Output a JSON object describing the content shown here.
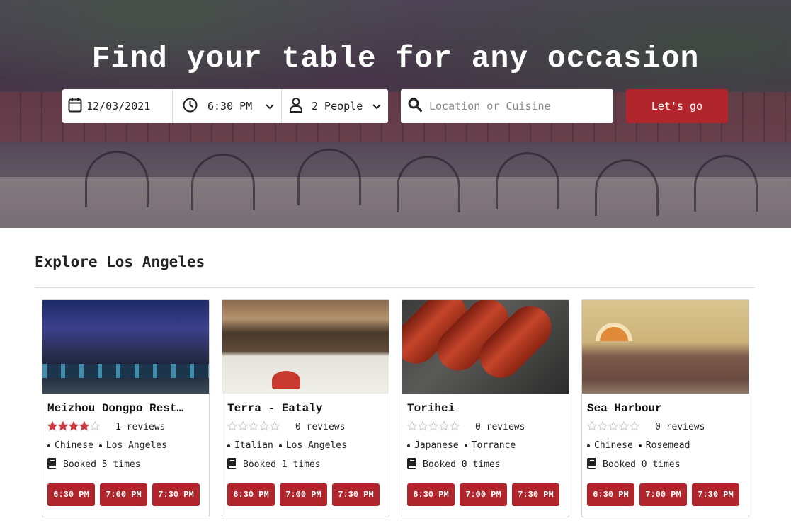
{
  "hero": {
    "title": "Find your table for any occasion",
    "date": "12/03/2021",
    "time": "6:30 PM",
    "party": "2 People",
    "search_placeholder": "Location or Cuisine",
    "go_label": "Let's go"
  },
  "explore": {
    "title": "Explore Los Angeles"
  },
  "colors": {
    "accent": "#b0262c",
    "star": "#d0393f"
  },
  "restaurants": [
    {
      "name": "Meizhou Dongpo Rest…",
      "rating": 4,
      "reviews": "1 reviews",
      "cuisine": "Chinese",
      "location": "Los Angeles",
      "booked": "Booked 5 times",
      "slots": [
        "6:30 PM",
        "7:00 PM",
        "7:30 PM"
      ]
    },
    {
      "name": "Terra - Eataly",
      "rating": 0,
      "reviews": "0 reviews",
      "cuisine": "Italian",
      "location": "Los Angeles",
      "booked": "Booked 1 times",
      "slots": [
        "6:30 PM",
        "7:00 PM",
        "7:30 PM"
      ]
    },
    {
      "name": "Torihei",
      "rating": 0,
      "reviews": "0 reviews",
      "cuisine": "Japanese",
      "location": "Torrance",
      "booked": "Booked 0 times",
      "slots": [
        "6:30 PM",
        "7:00 PM",
        "7:30 PM"
      ]
    },
    {
      "name": "Sea Harbour",
      "rating": 0,
      "reviews": "0 reviews",
      "cuisine": "Chinese",
      "location": "Rosemead",
      "booked": "Booked 0 times",
      "slots": [
        "6:30 PM",
        "7:00 PM",
        "7:30 PM"
      ]
    }
  ]
}
